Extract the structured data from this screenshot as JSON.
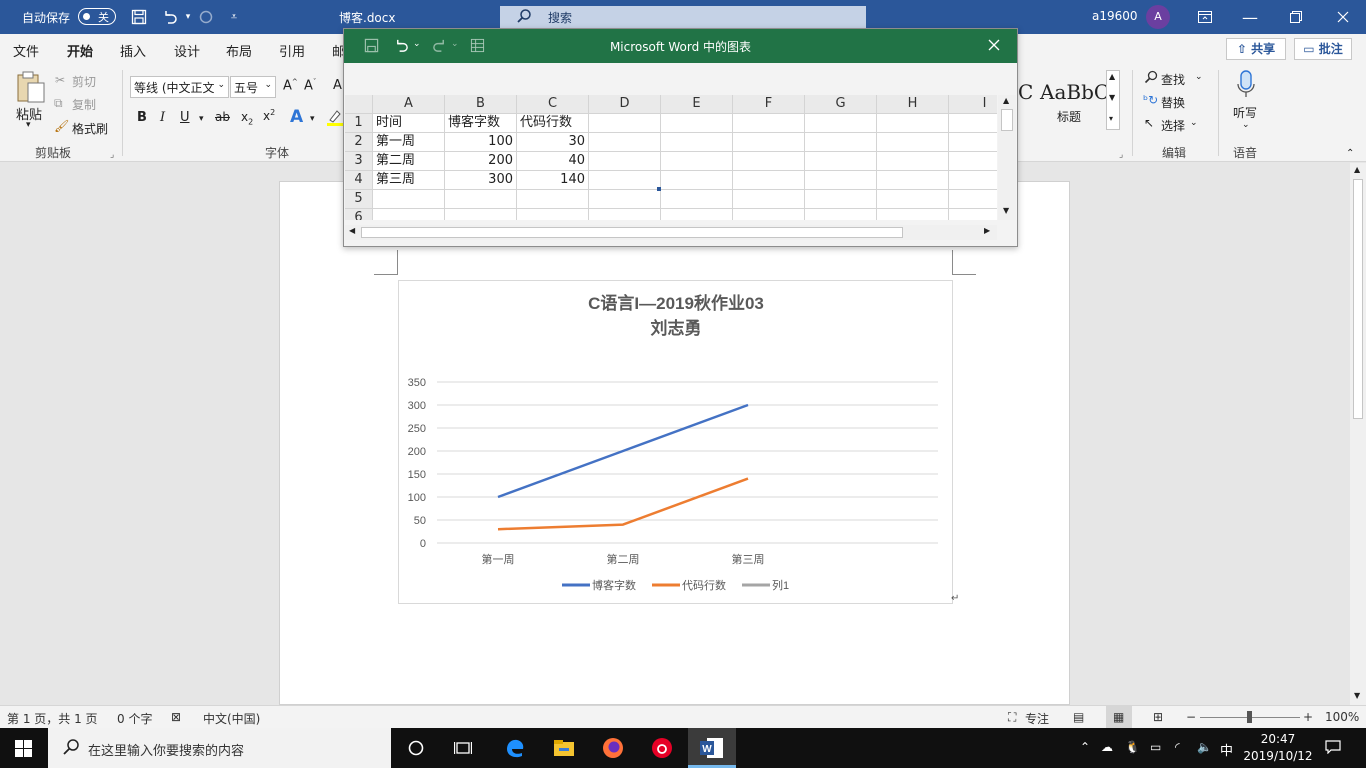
{
  "titlebar": {
    "autosave_label": "自动保存",
    "autosave_state": "关",
    "doc_title": "博客.docx",
    "search_label": "搜索",
    "username": "a19600",
    "avatar_initial": "A"
  },
  "tabs": [
    {
      "label": "文件"
    },
    {
      "label": "开始"
    },
    {
      "label": "插入"
    },
    {
      "label": "设计"
    },
    {
      "label": "布局"
    },
    {
      "label": "引用"
    },
    {
      "label": "邮"
    }
  ],
  "share_label": "共享",
  "comments_label": "批注",
  "ribbon": {
    "clipboard": {
      "paste": "粘贴",
      "cut": "剪切",
      "copy": "复制",
      "format_painter": "格式刷",
      "group_label": "剪贴板"
    },
    "font": {
      "font_name": "等线 (中文正文",
      "font_size": "五号",
      "group_label": "字体"
    },
    "styles": {
      "sample": "AaBbC",
      "sample_cut": "C",
      "heading_label": "标题"
    },
    "editing": {
      "find": "查找",
      "replace": "替换",
      "select": "选择",
      "group_label": "编辑"
    },
    "voice": {
      "dictate": "听写",
      "group_label": "语音"
    }
  },
  "datasheet": {
    "window_title": "Microsoft Word 中的图表",
    "columns": [
      "A",
      "B",
      "C",
      "D",
      "E",
      "F",
      "G",
      "H",
      "I"
    ],
    "row_numbers": [
      "1",
      "2",
      "3",
      "4",
      "5",
      "6"
    ],
    "header_row": [
      "时间",
      "博客字数",
      "代码行数"
    ],
    "rows": [
      [
        "第一周",
        "100",
        "30"
      ],
      [
        "第二周",
        "200",
        "40"
      ],
      [
        "第三周",
        "300",
        "140"
      ]
    ]
  },
  "chart_data": {
    "type": "line",
    "title": "C语言I—2019秋作业03",
    "subtitle": "刘志勇",
    "categories": [
      "第一周",
      "第二周",
      "第三周"
    ],
    "series": [
      {
        "name": "博客字数",
        "values": [
          100,
          200,
          300
        ],
        "color": "#4472c4"
      },
      {
        "name": "代码行数",
        "values": [
          30,
          40,
          140
        ],
        "color": "#ed7d31"
      },
      {
        "name": "列1",
        "values": [],
        "color": "#a5a5a5"
      }
    ],
    "yticks": [
      "0",
      "50",
      "100",
      "150",
      "200",
      "250",
      "300",
      "350"
    ],
    "ylim": [
      0,
      350
    ],
    "grid": true,
    "legend_position": "bottom"
  },
  "statusbar": {
    "page_info": "第 1 页，共 1 页",
    "word_count": "0 个字",
    "language": "中文(中国)",
    "focus": "专注",
    "zoom": "100%"
  },
  "taskbar": {
    "search_placeholder": "在这里输入你要搜索的内容",
    "ime": "中",
    "time": "20:47",
    "date": "2019/10/12"
  },
  "colors": {
    "word_blue": "#2b579a",
    "excel_green": "#217346"
  }
}
